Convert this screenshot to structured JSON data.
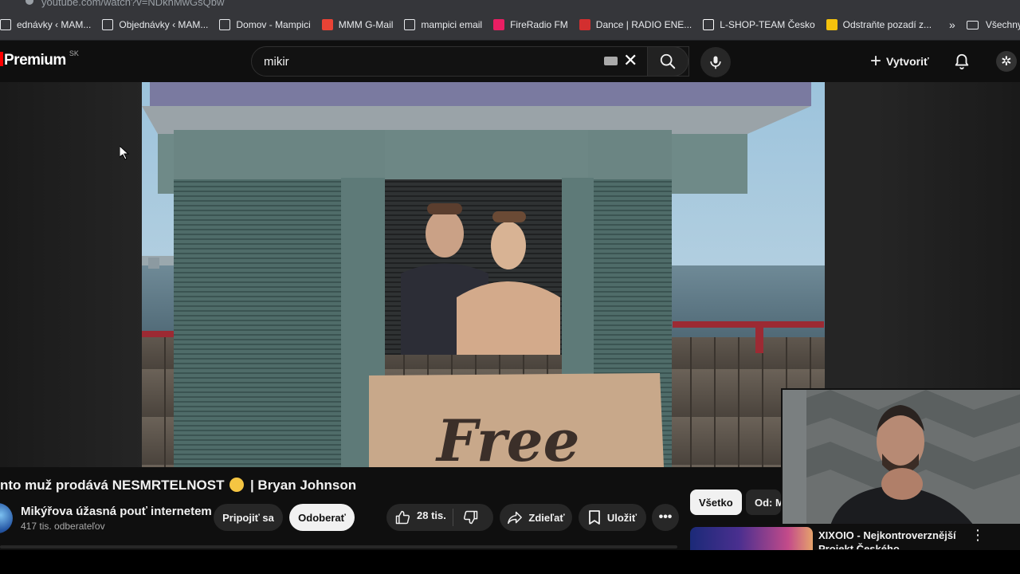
{
  "browser": {
    "url": "youtube.com/watch?v=NDknMwGsQbw"
  },
  "bookmarks": [
    {
      "label": "ednávky ‹ MAM...",
      "icon": "wordpress-icon",
      "color": "#e8eaed"
    },
    {
      "label": "Objednávky ‹ MAM...",
      "icon": "wordpress-icon",
      "color": "#e8eaed"
    },
    {
      "label": "Domov - Mampici",
      "icon": "wordpress-icon",
      "color": "#e8eaed"
    },
    {
      "label": "MMM G-Mail",
      "icon": "gmail-icon",
      "color": "#ea4335"
    },
    {
      "label": "mampici email",
      "icon": "mail-icon",
      "color": "#e8eaed"
    },
    {
      "label": "FireRadio FM",
      "icon": "fireradio-icon",
      "color": "#e91e63"
    },
    {
      "label": "Dance | RADIO ENE...",
      "icon": "energy-icon",
      "color": "#d32f2f"
    },
    {
      "label": "L-SHOP-TEAM Česko",
      "icon": "lshop-icon",
      "color": "#ffffff"
    },
    {
      "label": "Odstraňte pozadí z...",
      "icon": "removebg-icon",
      "color": "#f4c20d"
    }
  ],
  "bookmarks_folder": "Všechny zá",
  "header": {
    "logo_text": "Premium",
    "logo_country": "SK",
    "search_value": "mikir",
    "create_label": "Vytvoriť"
  },
  "video": {
    "sign_text": "Free"
  },
  "info": {
    "title": "nto muž prodává NESMRTELNOST",
    "title_suffix": "| Bryan Johnson",
    "channel_name": "Mikýřova úžasná pouť internetem",
    "subscribers": "417 tis. odberateľov",
    "join_label": "Pripojiť sa",
    "subscribe_label": "Odoberať",
    "likes": "28 tis.",
    "share_label": "Zdieľať",
    "save_label": "Uložiť"
  },
  "sidebar": {
    "chips": [
      "Všetko",
      "Od: M"
    ],
    "recommendation": {
      "title": "XIXOIO - Nejkontroverznější Projekt Českého Kryptosvěta"
    }
  }
}
